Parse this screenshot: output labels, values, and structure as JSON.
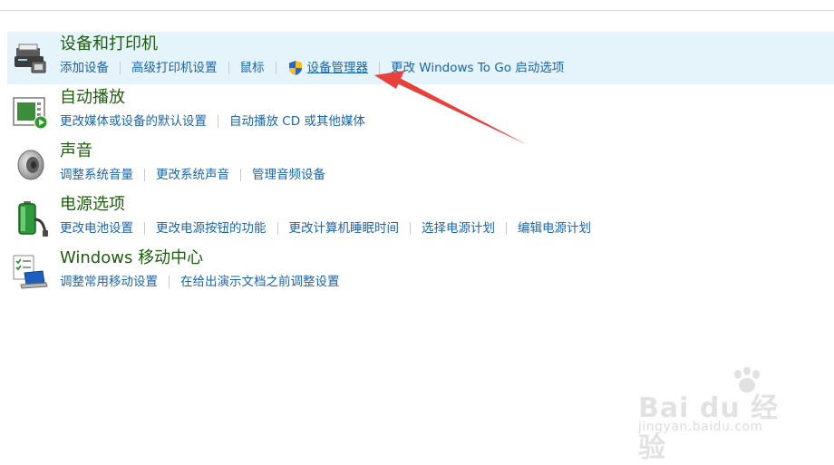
{
  "groups": [
    {
      "title": "设备和打印机",
      "icon": "printer-device-icon",
      "links": [
        "添加设备",
        "高级打印机设置",
        "鼠标",
        "设备管理器",
        "更改 Windows To Go 启动选项"
      ]
    },
    {
      "title": "自动播放",
      "icon": "autoplay-icon",
      "links": [
        "更改媒体或设备的默认设置",
        "自动播放 CD 或其他媒体"
      ]
    },
    {
      "title": "声音",
      "icon": "speaker-icon",
      "links": [
        "调整系统音量",
        "更改系统声音",
        "管理音频设备"
      ]
    },
    {
      "title": "电源选项",
      "icon": "battery-power-icon",
      "links": [
        "更改电池设置",
        "更改电源按钮的功能",
        "更改计算机睡眠时间",
        "选择电源计划",
        "编辑电源计划"
      ]
    },
    {
      "title": "Windows 移动中心",
      "icon": "mobility-center-icon",
      "links": [
        "调整常用移动设置",
        "在给出演示文档之前调整设置"
      ]
    }
  ],
  "watermark": {
    "brand": "Bai du 经验",
    "url": "jingyan.baidu.com"
  },
  "colors": {
    "title": "#1e5d0f",
    "link": "#1a64a8",
    "selected_bg": "#e5f3fb",
    "arrow": "#e8403a"
  }
}
